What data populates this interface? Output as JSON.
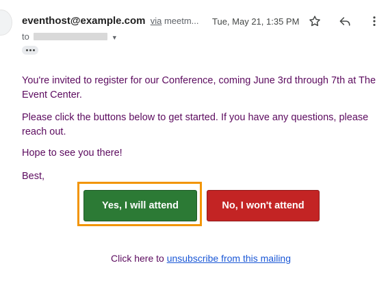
{
  "header": {
    "sender_email": "eventhost@example.com",
    "via_label": "via",
    "via_sender": "meetm...",
    "date": "Tue, May 21, 1:35 PM",
    "to_label": "to",
    "icons": [
      "star-icon",
      "reply-icon",
      "more-vert-icon",
      "expand-chevron-icon",
      "more-dots-icon"
    ]
  },
  "body": {
    "paragraph_1": "You're invited to register for our Conference, coming June 3rd through 7th at The Event Center.",
    "paragraph_2": "Please click the buttons below to get started. If you have any questions, please reach out.",
    "paragraph_3": "Hope to see you there!",
    "closing": "Best,"
  },
  "buttons": {
    "yes_label": "Yes, I will attend",
    "no_label": "No, I won't attend"
  },
  "footer": {
    "prefix": "Click here to",
    "link_text": "unsubscribe from this mailing"
  },
  "colors": {
    "body_text": "#5b0a5e",
    "yes_button": "#2c7a35",
    "no_button": "#c32424",
    "highlight": "#f29400",
    "link": "#1a57d6"
  }
}
